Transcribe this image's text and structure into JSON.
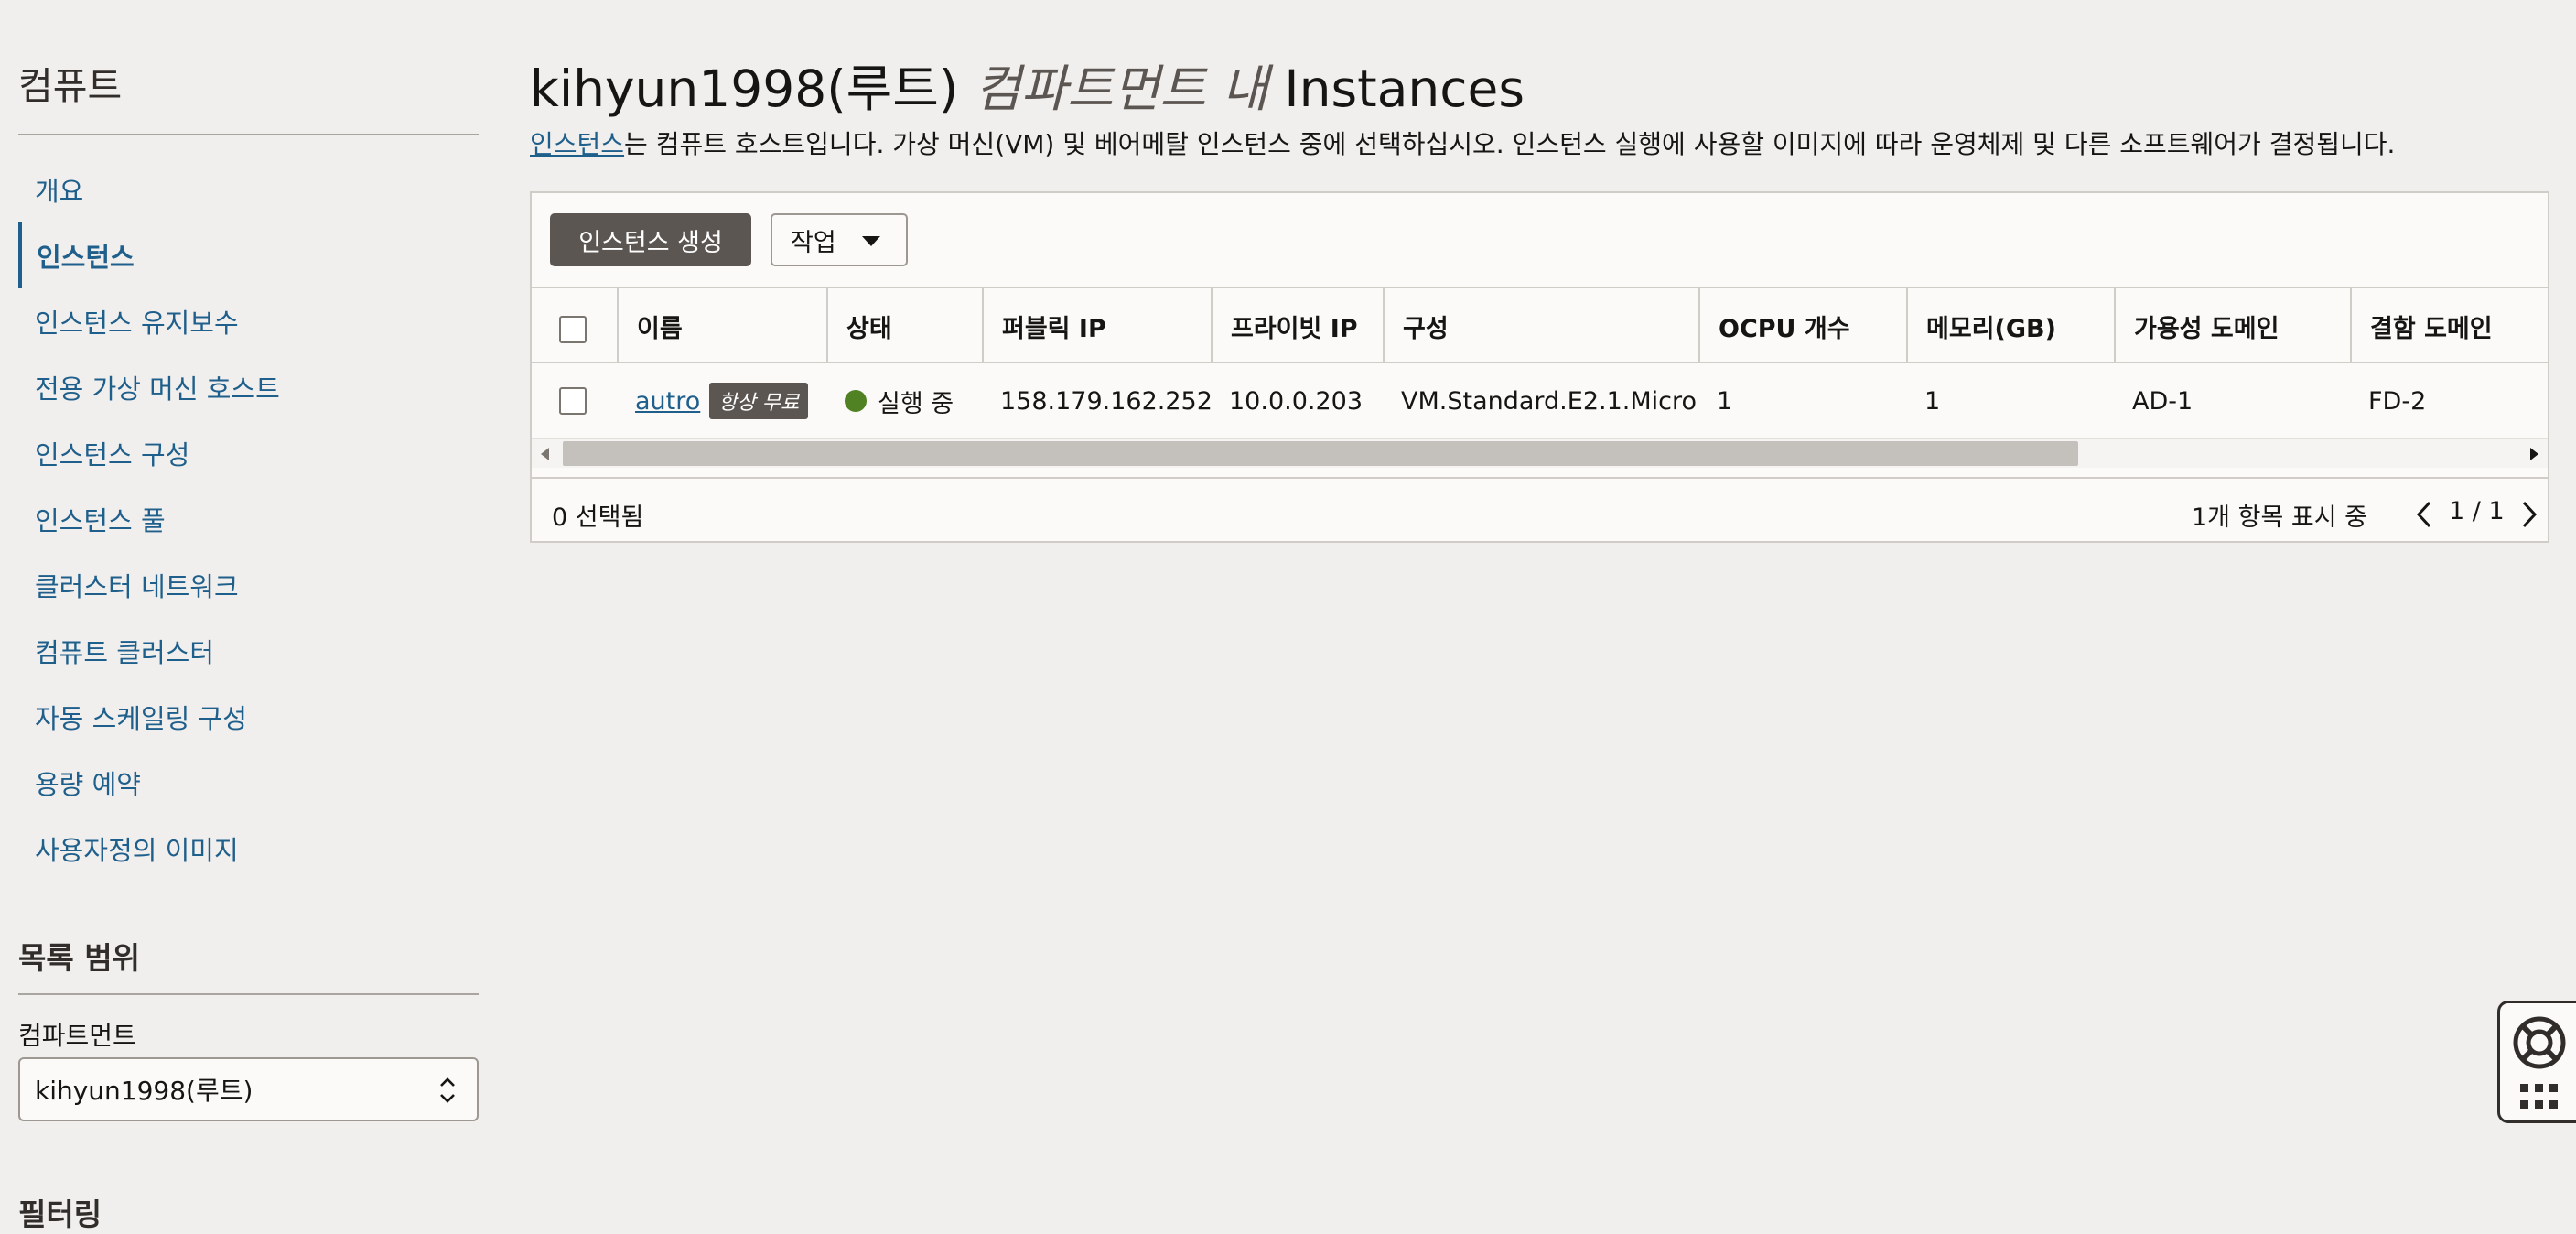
{
  "sidebar": {
    "title": "컴퓨트",
    "items": [
      {
        "label": "개요"
      },
      {
        "label": "인스턴스"
      },
      {
        "label": "인스턴스 유지보수"
      },
      {
        "label": "전용 가상 머신 호스트"
      },
      {
        "label": "인스턴스 구성"
      },
      {
        "label": "인스턴스 풀"
      },
      {
        "label": "클러스터 네트워크"
      },
      {
        "label": "컴퓨트 클러스터"
      },
      {
        "label": "자동 스케일링 구성"
      },
      {
        "label": "용량 예약"
      },
      {
        "label": "사용자정의 이미지"
      }
    ],
    "active_item": "인스턴스",
    "scope": {
      "title": "목록 범위",
      "compartment_label": "컴파트먼트",
      "compartment_value": "kihyun1998(루트)"
    },
    "filters_title": "필터링"
  },
  "main": {
    "title": {
      "compartment": "kihyun1998(루트)",
      "in_compartment": "컴파트먼트 내",
      "resource": "Instances"
    },
    "description": {
      "link": "인스턴스",
      "text": "는 컴퓨트 호스트입니다. 가상 머신(VM) 및 베어메탈 인스턴스 중에 선택하십시오. 인스턴스 실행에 사용할 이미지에 따라 운영체제 및 다른 소프트웨어가 결정됩니다."
    },
    "toolbar": {
      "create_label": "인스턴스 생성",
      "actions_label": "작업"
    },
    "table": {
      "columns": [
        "이름",
        "상태",
        "퍼블릭 IP",
        "프라이빗 IP",
        "구성",
        "OCPU 개수",
        "메모리(GB)",
        "가용성 도메인",
        "결함 도메인"
      ],
      "rows": [
        {
          "name": "autro",
          "badge": "항상 무료",
          "status": "실행 중",
          "public_ip": "158.179.162.252",
          "private_ip": "10.0.0.203",
          "shape": "VM.Standard.E2.1.Micro",
          "ocpu": "1",
          "memory": "1",
          "availability_domain": "AD-1",
          "fault_domain": "FD-2"
        }
      ]
    },
    "footer": {
      "selected": "0 선택됨",
      "items_shown": "1개 항목 표시 중",
      "page": "1 / 1"
    }
  },
  "colors": {
    "background": "#f1efed",
    "link": "#1f5f8b",
    "primary_button": "#5b5652",
    "status_running": "#508223"
  },
  "icons": [
    "chevron-updown-icon",
    "caret-down-icon",
    "chevron-left-icon",
    "chevron-right-icon",
    "lifebuoy-icon",
    "apps-grid-icon",
    "status-running-icon"
  ]
}
